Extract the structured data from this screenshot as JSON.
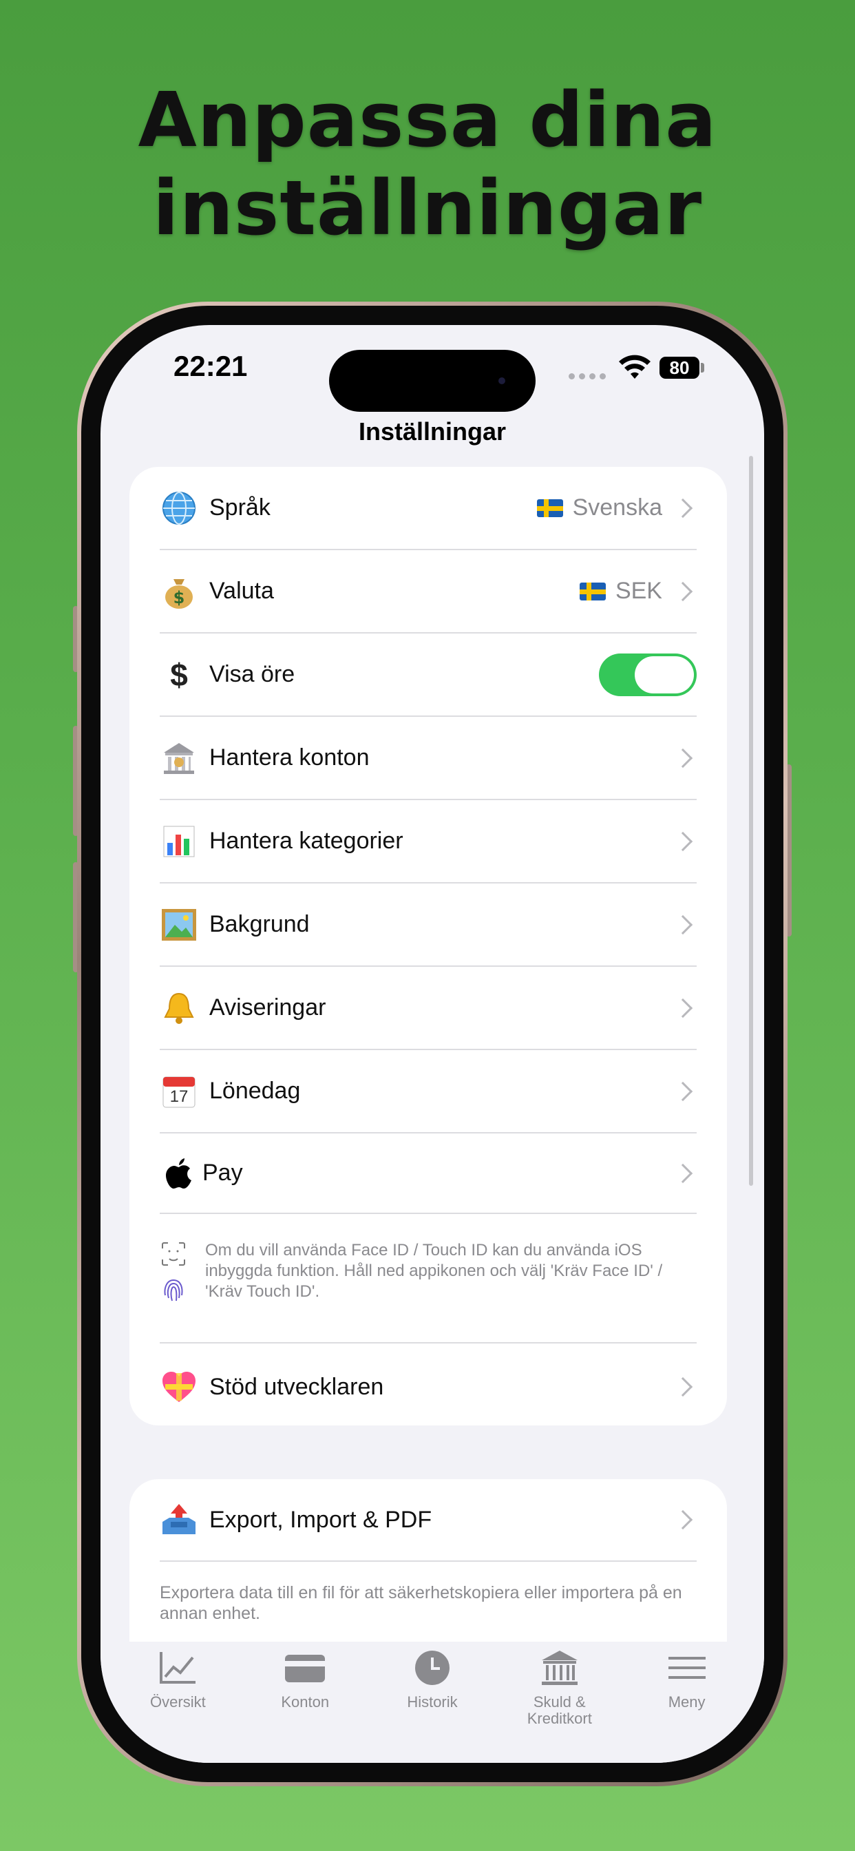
{
  "headline": {
    "line1": "Anpassa dina",
    "line2": "inställningar"
  },
  "status_bar": {
    "time": "22:21",
    "battery": "80"
  },
  "nav": {
    "title": "Inställningar"
  },
  "settings": {
    "language": {
      "label": "Språk",
      "value": "Svenska",
      "icon": "globe-icon"
    },
    "currency": {
      "label": "Valuta",
      "value": "SEK",
      "icon": "money-bag-icon"
    },
    "show_ore": {
      "label": "Visa öre",
      "toggle_on": true,
      "icon": "dollar-icon"
    },
    "accounts": {
      "label": "Hantera konton",
      "icon": "bank-icon"
    },
    "categories": {
      "label": "Hantera kategorier",
      "icon": "bar-chart-icon"
    },
    "background": {
      "label": "Bakgrund",
      "icon": "picture-icon"
    },
    "notifications": {
      "label": "Aviseringar",
      "icon": "bell-icon"
    },
    "payday": {
      "label": "Lönedag",
      "icon": "calendar-icon",
      "calendar_day": "17"
    },
    "apple_pay": {
      "label": "Pay",
      "icon": "apple-icon"
    },
    "faceid_note": "Om du vill använda Face ID / Touch ID kan du använda iOS inbyggda funktion. Håll ned appikonen och välj 'Kräv Face ID' / 'Kräv Touch ID'.",
    "support": {
      "label": "Stöd utvecklaren",
      "icon": "heart-icon"
    }
  },
  "export": {
    "label": "Export, Import & PDF",
    "icon": "outbox-tray-icon",
    "description": "Exportera data till en fil för att säkerhetskopiera eller importera på en annan enhet."
  },
  "tabbar": {
    "overview": "Översikt",
    "accounts": "Konton",
    "history": "Historik",
    "debt": "Skuld & Kreditkort",
    "menu": "Meny"
  },
  "colors": {
    "toggle_on": "#34c759",
    "background_top": "#4a9d3e",
    "background_bottom": "#7cc865"
  }
}
